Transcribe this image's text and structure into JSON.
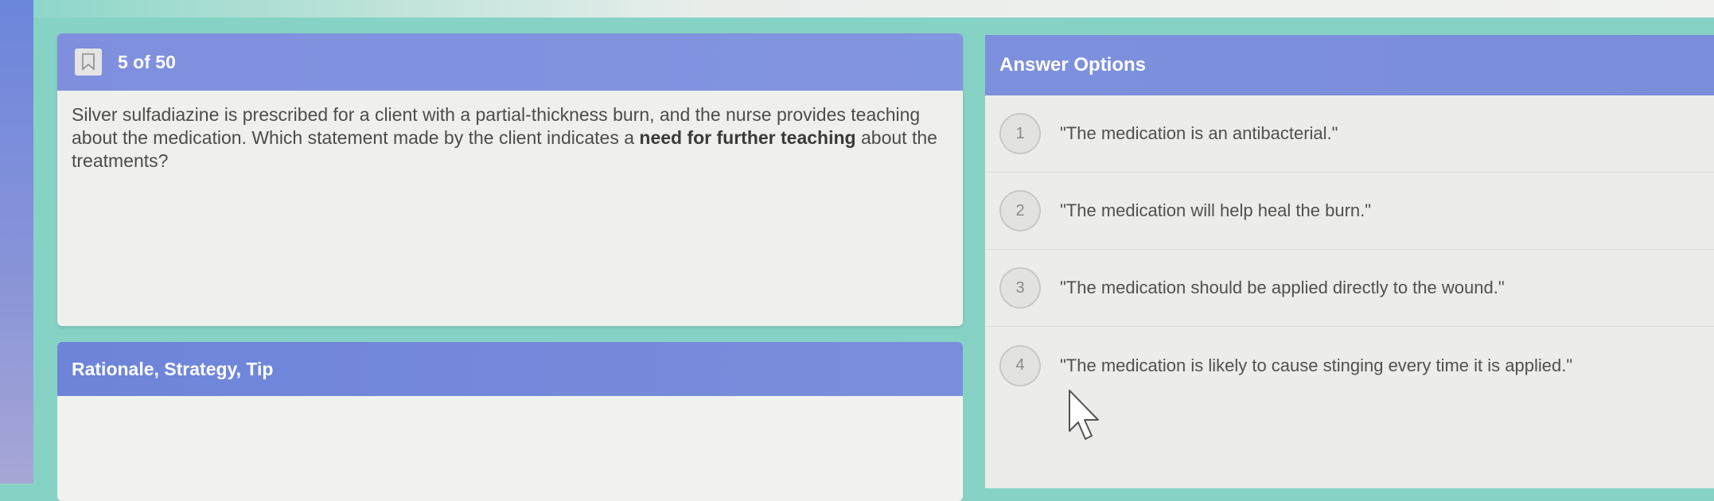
{
  "question": {
    "counter": "5 of 50",
    "text_before": "Silver sulfadiazine is prescribed for a client with a partial-thickness burn, and the nurse provides teaching about the medication. Which statement made by the client indicates a ",
    "text_bold": "need for further teaching",
    "text_after": " about the treatments?"
  },
  "rationale": {
    "title": "Rationale, Strategy, Tip"
  },
  "answers": {
    "title": "Answer Options",
    "options": [
      {
        "number": "1",
        "text": "\"The medication is an antibacterial.\""
      },
      {
        "number": "2",
        "text": "\"The medication will help heal the burn.\""
      },
      {
        "number": "3",
        "text": "\"The medication should be applied directly to the wound.\""
      },
      {
        "number": "4",
        "text": "\"The medication is likely to cause stinging every time it is applied.\""
      }
    ]
  },
  "icons": {
    "bookmark": "bookmark-icon",
    "cursor": "mouse-pointer-icon"
  }
}
